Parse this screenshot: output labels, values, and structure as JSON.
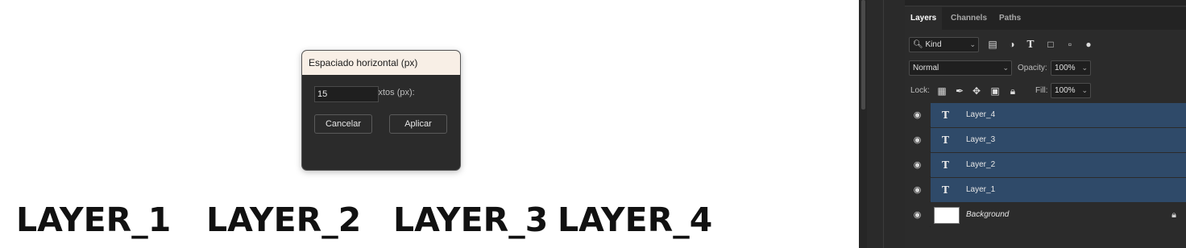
{
  "canvas": {
    "texts": [
      "LAYER_1",
      "LAYER_2",
      "LAYER_3",
      "LAYER_4"
    ]
  },
  "dialog": {
    "title": "Espaciado horizontal (px)",
    "label": "Espacio entre textos (px):",
    "input_value": "15",
    "cancel_label": "Cancelar",
    "apply_label": "Aplicar"
  },
  "panel": {
    "tabs": [
      "Layers",
      "Channels",
      "Paths"
    ],
    "active_tab": "Layers",
    "filter": {
      "kind_label": "Kind"
    },
    "blend_mode": "Normal",
    "opacity_label": "Opacity:",
    "opacity_value": "100%",
    "lock_label": "Lock:",
    "fill_label": "Fill:",
    "fill_value": "100%",
    "layers": [
      {
        "name": "Layer_4",
        "type": "text",
        "selected": true
      },
      {
        "name": "Layer_3",
        "type": "text",
        "selected": true
      },
      {
        "name": "Layer_2",
        "type": "text",
        "selected": true
      },
      {
        "name": "Layer_1",
        "type": "text",
        "selected": true
      },
      {
        "name": "Background",
        "type": "background",
        "selected": false,
        "locked": true
      }
    ]
  },
  "colors": {
    "selection": "#2f4a69",
    "panel_bg": "#2b2b2b",
    "dialog_title_bg": "#f8efe6"
  }
}
